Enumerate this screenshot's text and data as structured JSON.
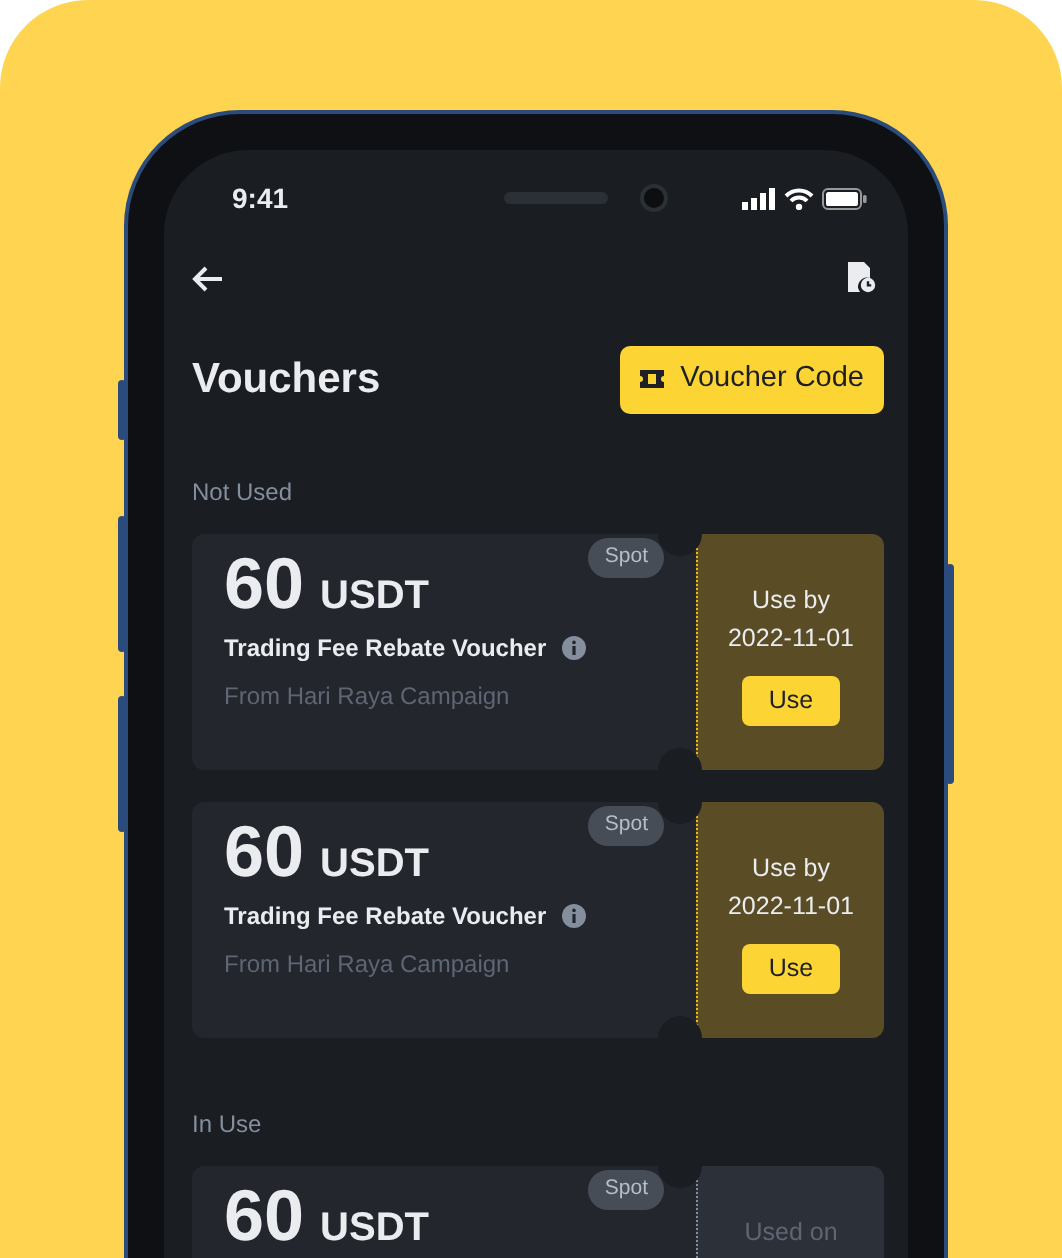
{
  "status_bar": {
    "time": "9:41"
  },
  "header": {
    "title": "Vouchers",
    "voucher_code_button": "Voucher Code"
  },
  "sections": [
    {
      "heading": "Not Used",
      "vouchers": [
        {
          "kind": "available",
          "amount": "60",
          "currency": "USDT",
          "tag": "Spot",
          "name": "Trading Fee Rebate Voucher",
          "source": "From Hari Raya Campaign",
          "stub_label": "Use by",
          "stub_date": "2022-11-01",
          "action": "Use"
        },
        {
          "kind": "available",
          "amount": "60",
          "currency": "USDT",
          "tag": "Spot",
          "name": "Trading Fee Rebate Voucher",
          "source": "From Hari Raya Campaign",
          "stub_label": "Use by",
          "stub_date": "2022-11-01",
          "action": "Use"
        }
      ]
    },
    {
      "heading": "In Use",
      "vouchers": [
        {
          "kind": "in_use",
          "amount": "60",
          "currency": "USDT",
          "tag": "Spot",
          "stub_label": "Used on"
        }
      ]
    }
  ]
}
